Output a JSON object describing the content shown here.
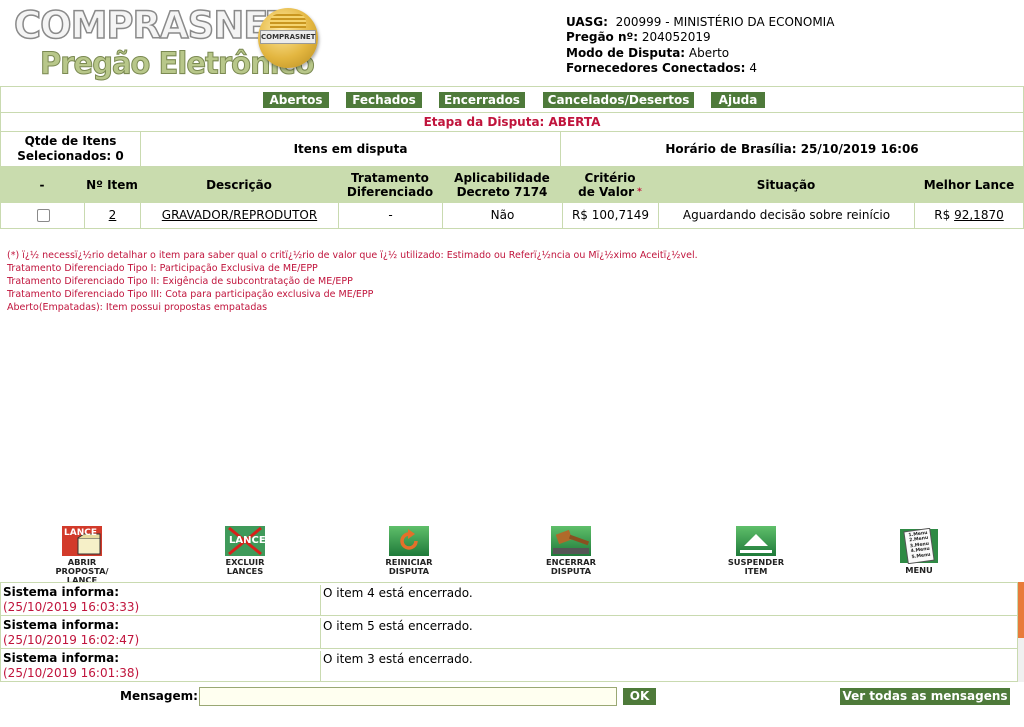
{
  "header": {
    "logo_title": "COMPRASNET",
    "logo_subtitle": "Pregão Eletrônico",
    "seal_text": "COMPRASNET",
    "info": [
      {
        "label": "UASG:",
        "value": "200999 - MINISTÉRIO DA ECONOMIA"
      },
      {
        "label": "Pregão nº:",
        "value": "204052019"
      },
      {
        "label": "Modo de Disputa:",
        "value": "Aberto"
      },
      {
        "label": "Fornecedores Conectados:",
        "value": "4"
      }
    ]
  },
  "nav": {
    "items": [
      "Abertos",
      "Fechados",
      "Encerrados",
      "Cancelados/Desertos",
      "Ajuda"
    ]
  },
  "etapa": "Etapa da Disputa: ABERTA",
  "summary": {
    "qtde_line1": "Qtde de Itens",
    "qtde_line2": "Selecionados: 0",
    "itens_disputa": "Itens em disputa",
    "horario": "Horário de Brasília: 25/10/2019 16:06"
  },
  "table": {
    "headers": [
      "-",
      "Nº Item",
      "Descrição",
      "Tratamento Diferenciado",
      "Aplicabilidade Decreto 7174",
      "Critério de Valor",
      "Situação",
      "Melhor Lance"
    ],
    "header_lines": {
      "tratamento": [
        "Tratamento",
        "Diferenciado"
      ],
      "aplicabilidade": [
        "Aplicabilidade",
        "Decreto 7174"
      ],
      "criterio": [
        "Critério",
        "de Valor"
      ]
    },
    "rows": [
      {
        "checked": false,
        "item": "2",
        "descricao": "GRAVADOR/REPRODUTOR",
        "tratamento": "-",
        "aplicabilidade": "Não",
        "criterio": "R$ 100,7149",
        "situacao": "Aguardando decisão sobre reinício",
        "melhor_lance_prefix": "R$",
        "melhor_lance": "92,1870"
      }
    ]
  },
  "notes": [
    "(*) ï¿½ necessï¿½rio detalhar o item para saber qual o critï¿½rio de valor que ï¿½ utilizado: Estimado ou Referï¿½ncia ou Mï¿½ximo Aceitï¿½vel.",
    "Tratamento Diferenciado Tipo I: Participação Exclusiva de ME/EPP",
    "Tratamento Diferenciado Tipo II: Exigência de subcontratação de ME/EPP",
    "Tratamento Diferenciado Tipo III: Cota para participação exclusiva de ME/EPP",
    "Aberto(Empatadas): Item possui propostas empatadas"
  ],
  "actions": [
    {
      "icon": "lance-icon",
      "icon_text": "LANCE",
      "label_lines": [
        "ABRIR",
        "PROPOSTA/",
        "LANCE"
      ]
    },
    {
      "icon": "excluir-lance-icon",
      "icon_text": "LANCE",
      "label_lines": [
        "EXCLUIR",
        "LANCES"
      ]
    },
    {
      "icon": "reload-icon",
      "label_lines": [
        "REINICIAR",
        "DISPUTA"
      ]
    },
    {
      "icon": "gavel-icon",
      "label_lines": [
        "ENCERRAR",
        "DISPUTA"
      ]
    },
    {
      "icon": "suspend-icon",
      "label_lines": [
        "SUSPENDER",
        "ITEM"
      ]
    },
    {
      "icon": "menu-icon",
      "icon_lines": [
        "1.Menu",
        "2.Menu",
        "3.Menu",
        "4.Menu",
        "5.Menu"
      ],
      "label_lines": [
        "MENU"
      ]
    }
  ],
  "messages": [
    {
      "who": "Sistema informa:",
      "timestamp": "(25/10/2019 16:03:33)",
      "text": "O item 4 está encerrado."
    },
    {
      "who": "Sistema informa:",
      "timestamp": "(25/10/2019 16:02:47)",
      "text": "O item 5 está encerrado."
    },
    {
      "who": "Sistema informa:",
      "timestamp": "(25/10/2019 16:01:38)",
      "text": "O item 3 está encerrado."
    }
  ],
  "footer": {
    "mensagem_label": "Mensagem:",
    "mensagem_value": "",
    "ok_label": "OK",
    "ver_todas_label": "Ver todas as mensagens"
  },
  "colors": {
    "nav_green": "#4e7a3a",
    "header_green": "#c9dcae",
    "alert_red": "#c0143c"
  }
}
